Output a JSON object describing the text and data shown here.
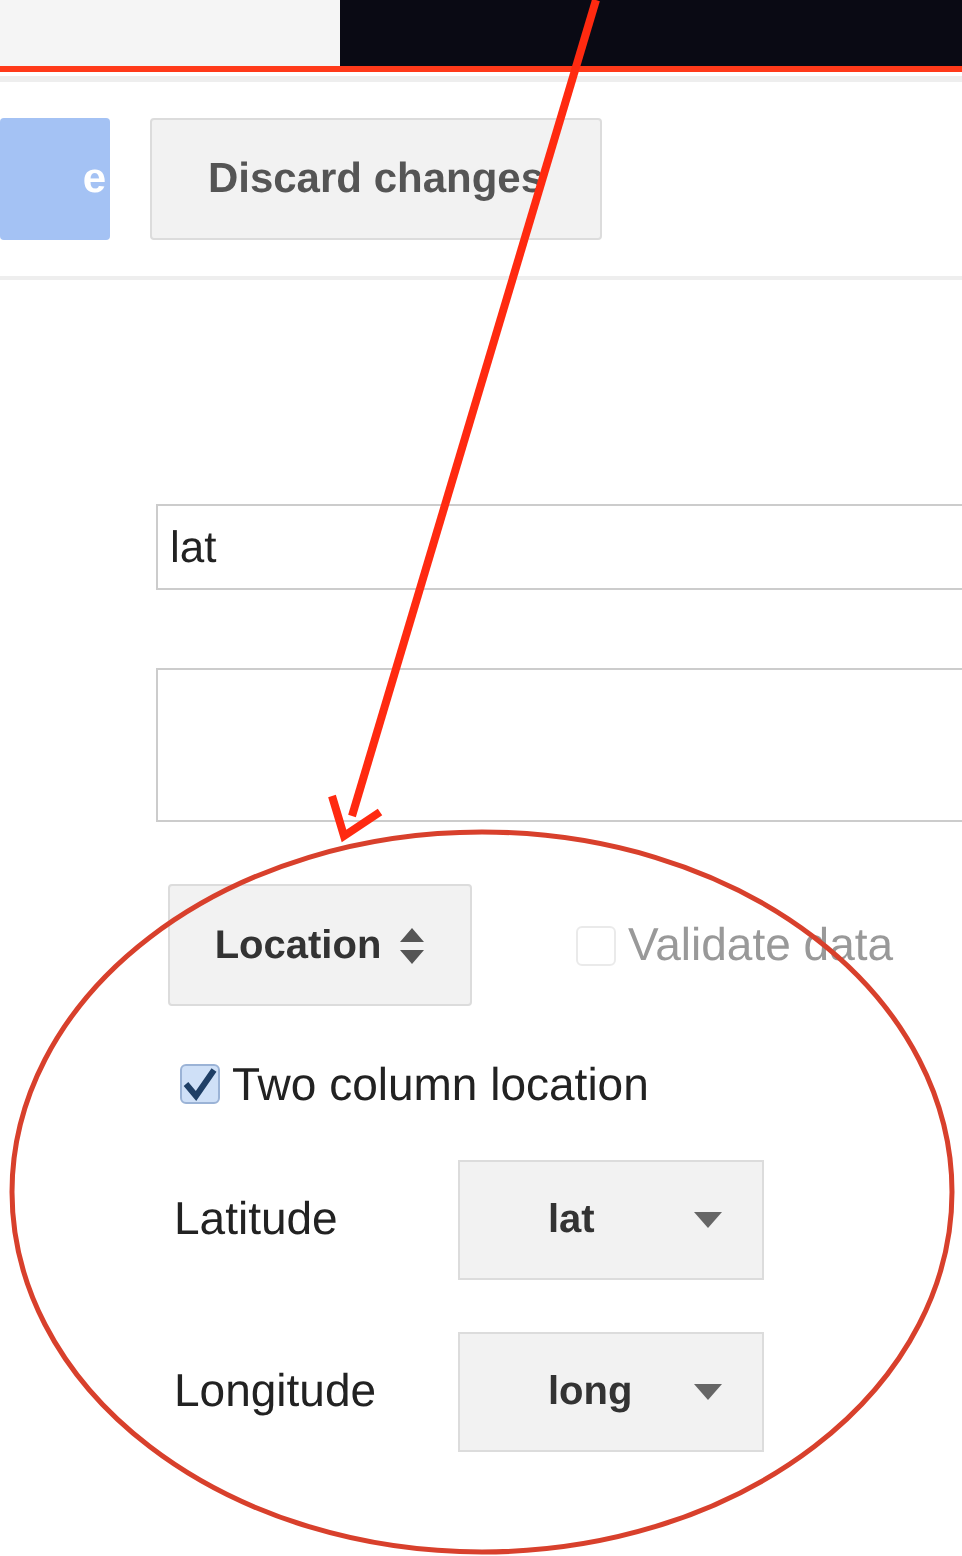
{
  "toolbar": {
    "buttons": [
      {
        "label": "e",
        "kind": "primary"
      },
      {
        "label": "Discard changes",
        "kind": "secondary"
      }
    ]
  },
  "form": {
    "name_field": {
      "value": "lat"
    },
    "type_select": {
      "value": "Location"
    },
    "validate_checkbox": {
      "label": "Validate data",
      "checked": false,
      "disabled": true
    },
    "two_column_checkbox": {
      "label": "Two column location",
      "checked": true,
      "disabled": false
    },
    "columns": [
      {
        "label": "Latitude",
        "value": "lat"
      },
      {
        "label": "Longitude",
        "value": "long"
      }
    ]
  }
}
